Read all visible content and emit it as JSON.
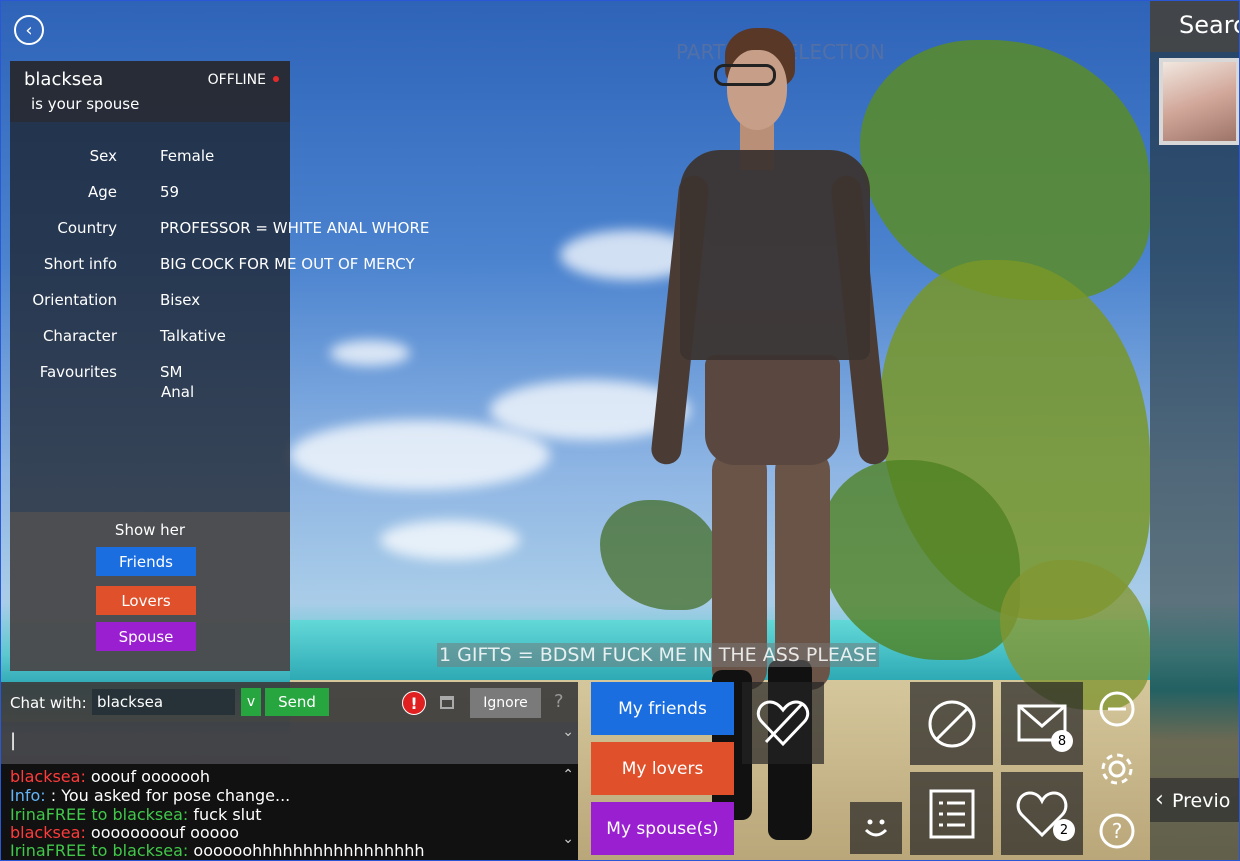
{
  "scene": {
    "title_overlay": "PARTNER SELECTION",
    "gifts_banner": "1 GIFTS = BDSM FUCK ME IN THE ASS PLEASE"
  },
  "profile": {
    "name": "blacksea",
    "relation": "is your spouse",
    "status": "OFFLINE",
    "fields": [
      {
        "label": "Sex",
        "value": "Female"
      },
      {
        "label": "Age",
        "value": "59"
      },
      {
        "label": "Country",
        "value": "PROFESSOR = WHITE ANAL WHORE"
      },
      {
        "label": "Short info",
        "value": "BIG COCK FOR ME OUT OF MERCY"
      },
      {
        "label": "Orientation",
        "value": "Bisex"
      },
      {
        "label": "Character",
        "value": "Talkative"
      },
      {
        "label": "Favourites",
        "value": "SM",
        "value2": "Anal"
      }
    ],
    "show_her": {
      "title": "Show her",
      "friends": "Friends",
      "lovers": "Lovers",
      "spouse": "Spouse"
    }
  },
  "search": {
    "title": "Search",
    "previous": "Previo"
  },
  "chat": {
    "with_label": "Chat with:",
    "with_name": "blacksea",
    "v_label": "v",
    "send_label": "Send",
    "alert_label": "!",
    "ignore_label": "Ignore",
    "help_label": "?",
    "input_value": "|",
    "log": [
      {
        "who": "blacksea:",
        "text": " ooouf ooooooh",
        "color": "red"
      },
      {
        "who": "Info:",
        "text": " : You asked for pose change...",
        "color": "blue"
      },
      {
        "who": "IrinaFREE to blacksea:",
        "text": " fuck slut",
        "color": "green"
      },
      {
        "who": "blacksea:",
        "text": " oooooooouf ooooo",
        "color": "red"
      },
      {
        "who": "IrinaFREE to blacksea:",
        "text": " oooooohhhhhhhhhhhhhhhhh",
        "color": "green"
      }
    ]
  },
  "relations": {
    "friends": "My friends",
    "lovers": "My lovers",
    "spouses": "My spouse(s)"
  },
  "icons": {
    "mail_count": "8",
    "heart_count": "2"
  },
  "colors": {
    "friends": "#1a6ee0",
    "lovers": "#e0502a",
    "spouse": "#9a1fd0",
    "send": "#27a640"
  }
}
